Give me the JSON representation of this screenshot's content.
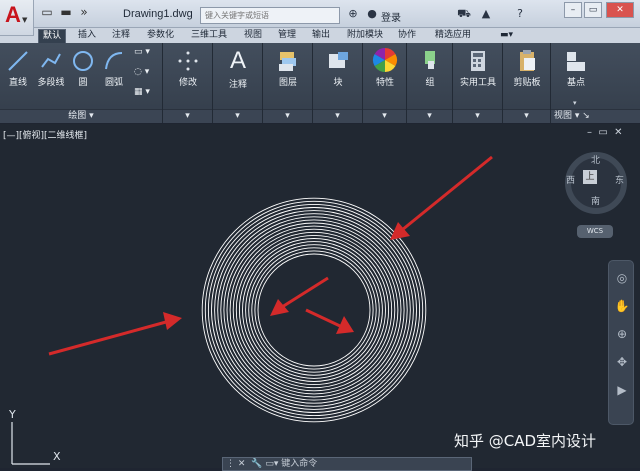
{
  "title_bar": {
    "document": "Drawing1.dwg",
    "search_placeholder": "键入关键字或短语",
    "login": "登录",
    "help": "?"
  },
  "tabs": [
    {
      "label": "默认",
      "active": true
    },
    {
      "label": "插入"
    },
    {
      "label": "注释"
    },
    {
      "label": "参数化"
    },
    {
      "label": "三维工具"
    },
    {
      "label": "视图"
    },
    {
      "label": "管理"
    },
    {
      "label": "输出"
    },
    {
      "label": "附加模块"
    },
    {
      "label": "协作"
    },
    {
      "label": "精选应用"
    }
  ],
  "ribbon": {
    "draw_tools": [
      "直线",
      "多段线",
      "圆",
      "圆弧"
    ],
    "draw_panel": "绘图",
    "modify": "修改",
    "annotate": "注释",
    "layers": "图层",
    "block": "块",
    "properties": "特性",
    "group": "组",
    "utilities": "实用工具",
    "clipboard": "剪贴板",
    "base": "基点",
    "view_panel": "视图"
  },
  "viewport": {
    "label": "[—][俯视][二维线框]",
    "compass": {
      "north": "北",
      "south": "南",
      "east": "东",
      "west": "西",
      "face": "上"
    },
    "wcs": "WCS",
    "ucs_y": "Y",
    "ucs_x": "X",
    "command_placeholder": "键入命令",
    "watermark": "知乎 @CAD室内设计"
  },
  "colors": {
    "canvas": "#212832",
    "ribbon": "#3a4452",
    "arrow": "#d42a2a",
    "rings": "#ffffff"
  }
}
